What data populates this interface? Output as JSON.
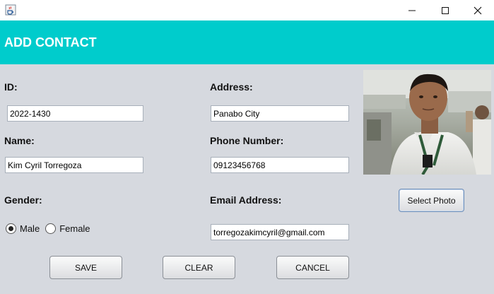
{
  "window": {
    "app_icon": "java-cup-icon",
    "minimize": "—",
    "maximize": "☐",
    "close": "✕"
  },
  "header": {
    "title": "ADD CONTACT"
  },
  "form": {
    "id_label": "ID:",
    "id_value": "2022-1430",
    "name_label": "Name:",
    "name_value": "Kim Cyril Torregoza",
    "gender_label": "Gender:",
    "gender_options": [
      "Male",
      "Female"
    ],
    "gender_selected": "Male",
    "address_label": "Address:",
    "address_value": "Panabo City",
    "phone_label": "Phone Number:",
    "phone_value": "09123456768",
    "email_label": "Email Address:",
    "email_value": "torregozakimcyril@gmail.com"
  },
  "photo": {
    "button_label": "Select Photo"
  },
  "actions": {
    "save": "SAVE",
    "clear": "CLEAR",
    "cancel": "CANCEL"
  },
  "colors": {
    "header": "#00cccc",
    "background": "#d6d9df"
  }
}
